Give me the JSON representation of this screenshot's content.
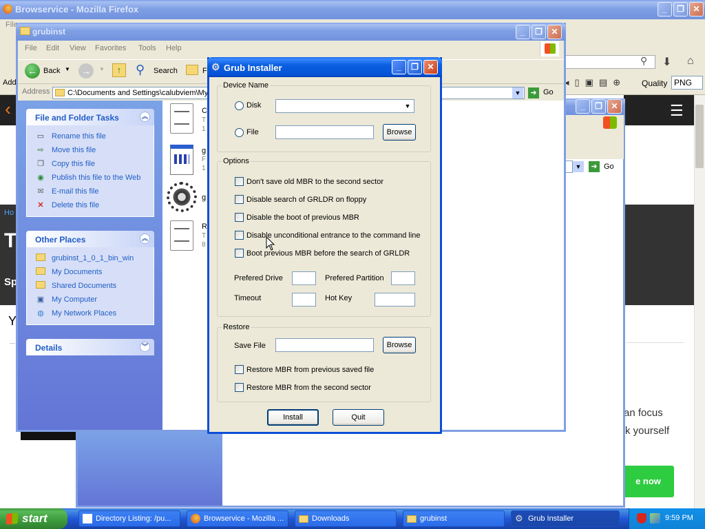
{
  "firefox": {
    "title": "Browservice - Mozilla Firefox",
    "menu_fragment": "File",
    "toolbar_fragment": "Add",
    "quality_label": "Quality",
    "quality_value": "PNG",
    "page_fragments": {
      "breadcrumb": "Ho",
      "heading": "T",
      "subheading": "Sp",
      "text_y": "Y",
      "focus_line1": "an focus",
      "focus_line2": "k yourself",
      "green_button": "e now"
    }
  },
  "explorer": {
    "title": "grubinst",
    "menu": [
      "File",
      "Edit",
      "View",
      "Favorites",
      "Tools",
      "Help"
    ],
    "toolbar": {
      "back": "Back",
      "search": "Search",
      "folders_fragment": "F"
    },
    "address_label": "Address",
    "address_value": "C:\\Documents and Settings\\calubviem\\My",
    "go_label": "Go",
    "file_tasks": {
      "title": "File and Folder Tasks",
      "items": [
        "Rename this file",
        "Move this file",
        "Copy this file",
        "Publish this file to the Web",
        "E-mail this file",
        "Delete this file"
      ]
    },
    "other_places": {
      "title": "Other Places",
      "items": [
        "grubinst_1_0_1_bin_win",
        "My Documents",
        "Shared Documents",
        "My Computer",
        "My Network Places"
      ]
    },
    "details": {
      "title": "Details"
    },
    "files": [
      {
        "name": "C",
        "line2": "T",
        "line3": "1"
      },
      {
        "name": "g",
        "line2": "F",
        "line3": "1"
      },
      {
        "name": "g",
        "line2": "",
        "line3": ""
      },
      {
        "name": "R",
        "line2": "T",
        "line3": "8"
      }
    ]
  },
  "window2": {
    "go_label": "Go"
  },
  "grub": {
    "title": "Grub Installer",
    "device_group": "Device Name",
    "disk_label": "Disk",
    "disk_value": "",
    "file_label": "File",
    "file_value": "",
    "browse_label": "Browse",
    "options_group": "Options",
    "options": [
      "Don't save old MBR to the second sector",
      "Disable search of GRLDR on floppy",
      "Disable the boot of previous MBR",
      "Disable unconditional entrance to the command line",
      "Boot previous MBR before the search of GRLDR"
    ],
    "prefered_drive_label": "Prefered Drive",
    "prefered_partition_label": "Prefered Partition",
    "timeout_label": "Timeout",
    "hotkey_label": "Hot Key",
    "restore_group": "Restore",
    "save_file_label": "Save File",
    "restore_options": [
      "Restore MBR from previous saved file",
      "Restore MBR from the second sector"
    ],
    "install_label": "Install",
    "quit_label": "Quit"
  },
  "taskbar": {
    "start_label": "start",
    "tasks": [
      "Directory Listing: /pu...",
      "Browservice - Mozilla ...",
      "Downloads",
      "grubinst",
      "Grub Installer"
    ],
    "active_task": "Grub Installer",
    "clock": "9:59 PM"
  },
  "colors": {
    "xp_blue": "#0553d8",
    "task_pane_blue": "#7ba2e7",
    "link_blue": "#215dc6",
    "dialog_face": "#ece9d8",
    "start_green": "#3c9a3c"
  }
}
